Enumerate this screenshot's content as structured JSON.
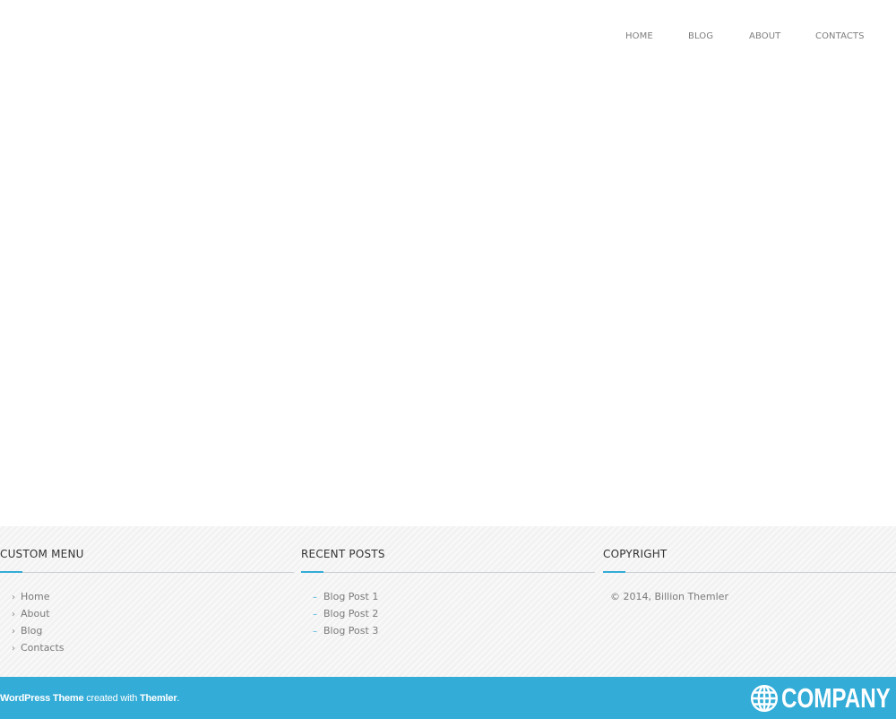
{
  "nav": {
    "items": [
      "HOME",
      "BLOG",
      "ABOUT",
      "CONTACTS"
    ]
  },
  "footer": {
    "custom_menu": {
      "title": "CUSTOM MENU",
      "items": [
        "Home",
        "About",
        "Blog",
        "Contacts"
      ],
      "marker": "›"
    },
    "recent_posts": {
      "title": "RECENT POSTS",
      "items": [
        "Blog Post 1",
        "Blog Post 2",
        "Blog Post 3"
      ],
      "marker": "–"
    },
    "copyright": {
      "title": "COPYRIGHT",
      "text": "© 2014, Billion Themler"
    }
  },
  "bottom_bar": {
    "credit_link_1": "WordPress Theme",
    "credit_middle": " created with ",
    "credit_link_2": "Themler",
    "credit_end": ".",
    "logo_text": "COMPANY",
    "logo_icon": "globe-icon",
    "background_color": "#33acd7"
  },
  "colors": {
    "accent": "#35acd6",
    "footer_bg": "#f2f2f2",
    "nav_text": "#7d7d7d"
  }
}
